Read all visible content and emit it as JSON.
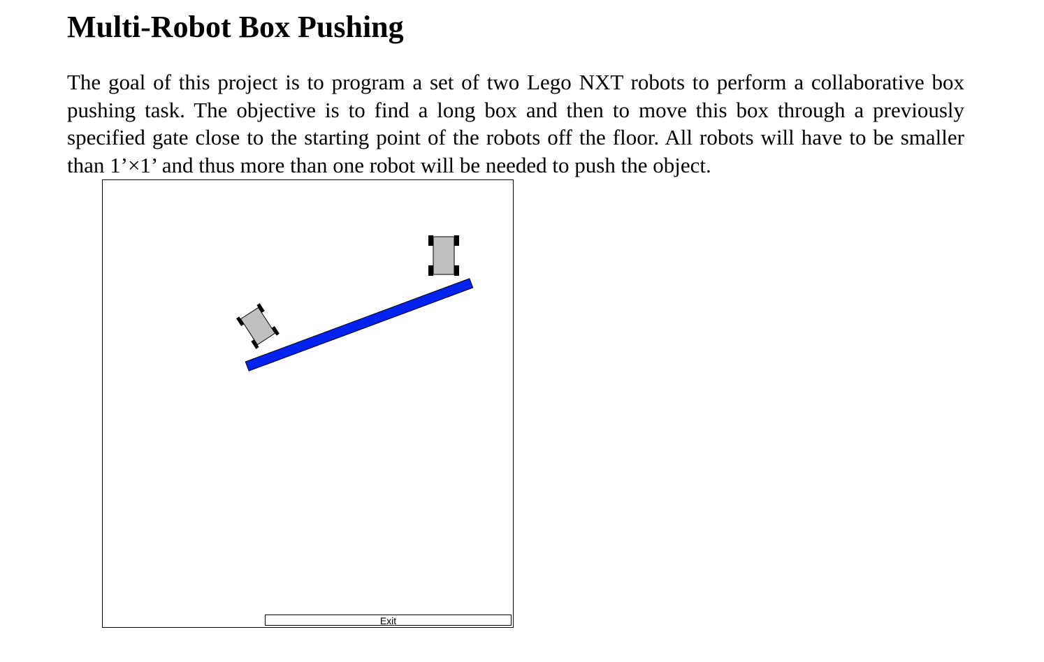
{
  "page": {
    "title": "Multi-Robot Box Pushing",
    "intro": "The goal of this project is to program a set of two Lego NXT robots to perform a collaborative box pushing task. The objective is to find a long box and then to move this box through a previously specified gate close to the starting point of the robots off the floor. All robots will have to be smaller than 1’×1’ and thus more than one robot will be needed to push the object."
  },
  "simulation": {
    "exit_label": "Exit",
    "box_color": "#0022ee",
    "robot_body_color": "#c0c0c0",
    "wheel_color": "#000000"
  }
}
